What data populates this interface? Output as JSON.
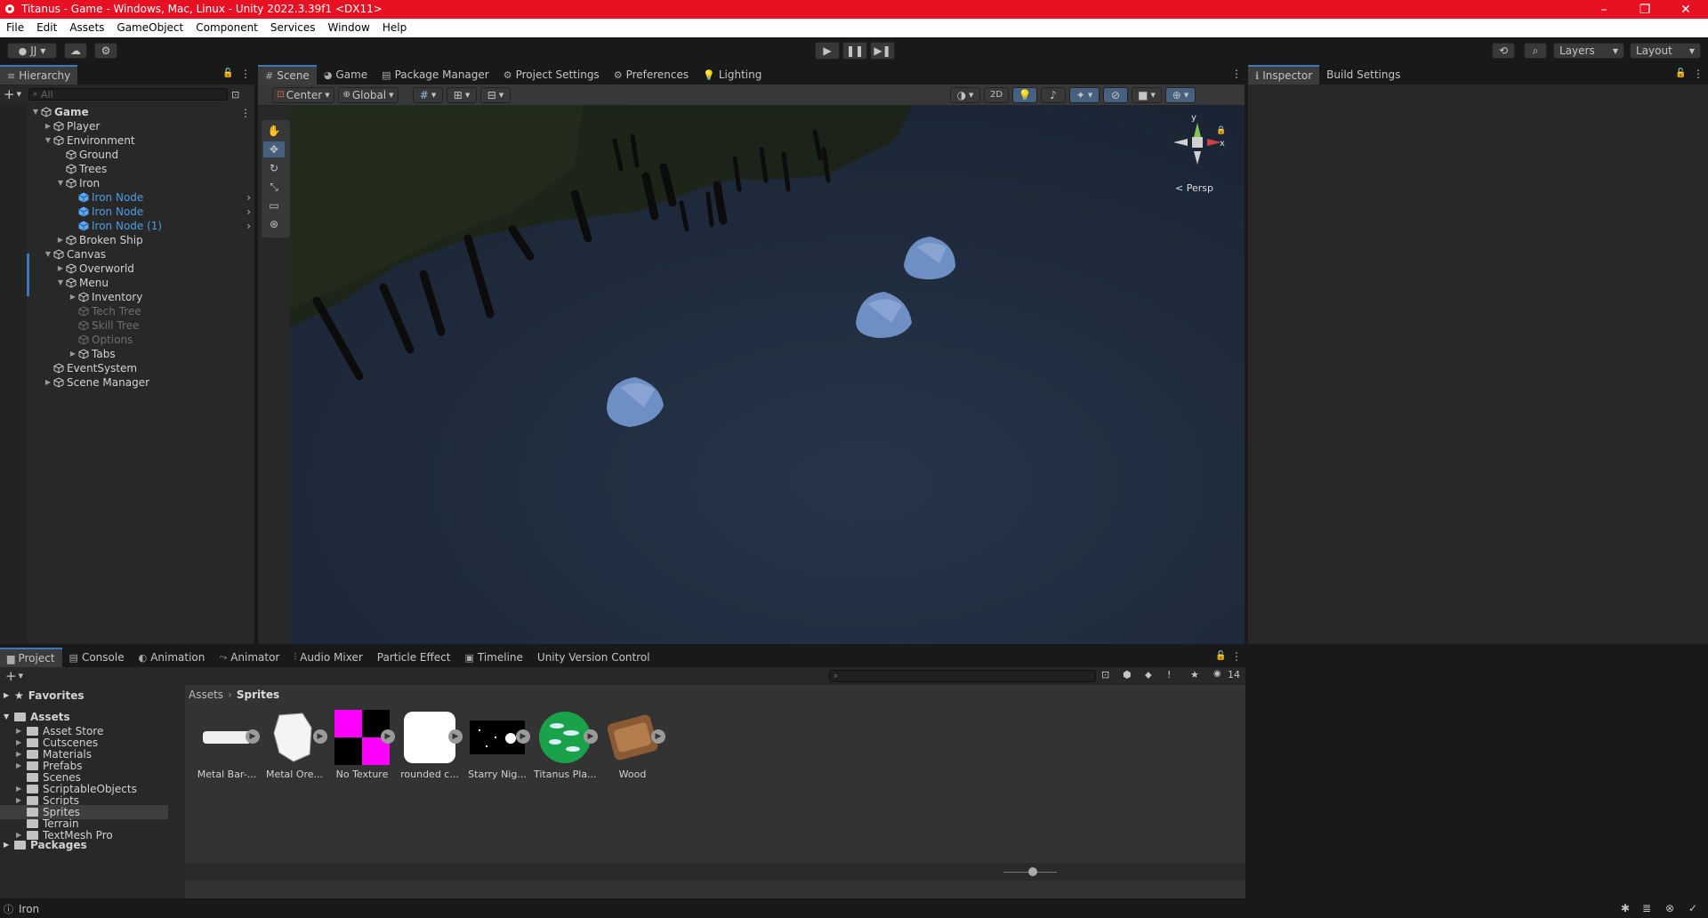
{
  "window": {
    "title": "Titanus - Game - Windows, Mac, Linux - Unity 2022.3.39f1 <DX11>",
    "controls": [
      "–",
      "❐",
      "✕"
    ]
  },
  "menu": [
    "File",
    "Edit",
    "Assets",
    "GameObject",
    "Component",
    "Services",
    "Window",
    "Help"
  ],
  "toolbar": {
    "account": "JJ",
    "layers": "Layers",
    "layout": "Layout"
  },
  "hierarchy": {
    "tab": "Hierarchy",
    "search_placeholder": "All",
    "items": [
      {
        "label": "Game",
        "depth": 0,
        "expanded": true,
        "bold": true
      },
      {
        "label": "Player",
        "depth": 1,
        "expanded": false
      },
      {
        "label": "Environment",
        "depth": 1,
        "expanded": true
      },
      {
        "label": "Ground",
        "depth": 2
      },
      {
        "label": "Trees",
        "depth": 2
      },
      {
        "label": "Iron",
        "depth": 2,
        "expanded": true
      },
      {
        "label": "Iron Node",
        "depth": 3,
        "selected": true
      },
      {
        "label": "Iron Node",
        "depth": 3,
        "selected": true
      },
      {
        "label": "Iron Node (1)",
        "depth": 3,
        "selected": true
      },
      {
        "label": "Broken Ship",
        "depth": 2,
        "expanded": false
      },
      {
        "label": "Canvas",
        "depth": 1,
        "expanded": true
      },
      {
        "label": "Overworld",
        "depth": 2,
        "expanded": false
      },
      {
        "label": "Menu",
        "depth": 2,
        "expanded": true
      },
      {
        "label": "Inventory",
        "depth": 3,
        "expanded": false
      },
      {
        "label": "Tech Tree",
        "depth": 3,
        "dim": true
      },
      {
        "label": "Skill Tree",
        "depth": 3,
        "dim": true
      },
      {
        "label": "Options",
        "depth": 3,
        "dim": true
      },
      {
        "label": "Tabs",
        "depth": 3,
        "expanded": false
      },
      {
        "label": "EventSystem",
        "depth": 1
      },
      {
        "label": "Scene Manager",
        "depth": 1,
        "expanded": false
      }
    ]
  },
  "scene_tabs": [
    "Scene",
    "Game",
    "Package Manager",
    "Project Settings",
    "Preferences",
    "Lighting"
  ],
  "scene_toolbar": {
    "pivot": "Center",
    "space": "Global",
    "mode_2d": "2D"
  },
  "gizmo": {
    "y": "y",
    "x": "x",
    "persp": "< Persp"
  },
  "inspector_tabs": [
    "Inspector",
    "Build Settings"
  ],
  "bottom_tabs": [
    "Project",
    "Console",
    "Animation",
    "Animator",
    "Audio Mixer",
    "Particle Effect",
    "Timeline",
    "Unity Version Control"
  ],
  "project": {
    "favorites": "Favorites",
    "assets": "Assets",
    "folders": [
      "Asset Store",
      "Cutscenes",
      "Materials",
      "Prefabs",
      "Scenes",
      "ScriptableObjects",
      "Scripts",
      "Sprites",
      "Terrain",
      "TextMesh Pro"
    ],
    "packages": "Packages",
    "breadcrumb": [
      "Assets",
      "Sprites"
    ],
    "hidden_count": "14",
    "sprites": [
      "Metal Bar-...",
      "Metal Ore...",
      "No Texture",
      "rounded c...",
      "Starry Nig...",
      "Titanus Pla...",
      "Wood"
    ]
  },
  "status": {
    "text": "Iron"
  }
}
